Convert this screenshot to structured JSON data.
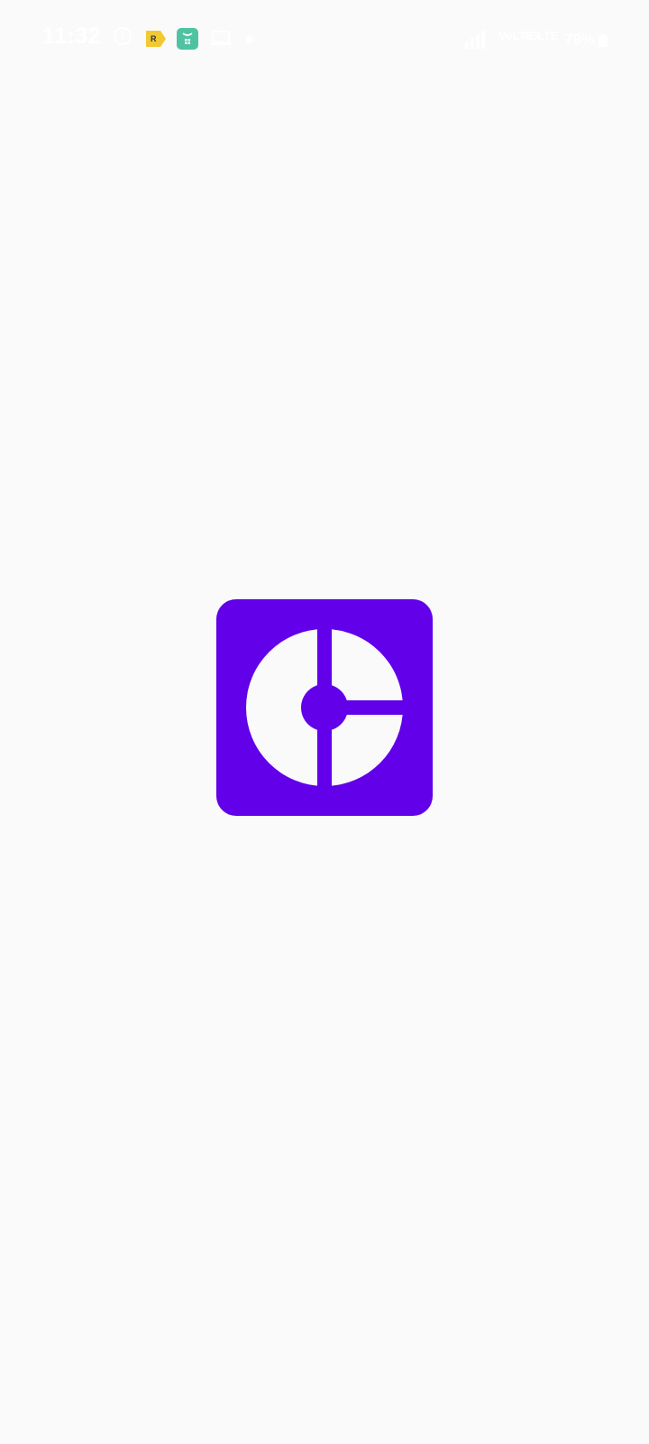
{
  "status_bar": {
    "time": "11:32",
    "info_glyph": "i",
    "tag_glyph": "R",
    "network_left": "LTE",
    "network_mid": "VoLTE",
    "network_right": "4G",
    "battery": "79%",
    "icons": [
      "info-icon",
      "tag-icon",
      "shopping-bag-icon",
      "laptop-icon",
      "dot-icon",
      "signal-icon",
      "wifi-icon",
      "battery-icon"
    ]
  },
  "splash": {
    "logo_icon": "app-logo-icon",
    "brand_color": "#6200ea",
    "background_color": "#fafafa"
  }
}
